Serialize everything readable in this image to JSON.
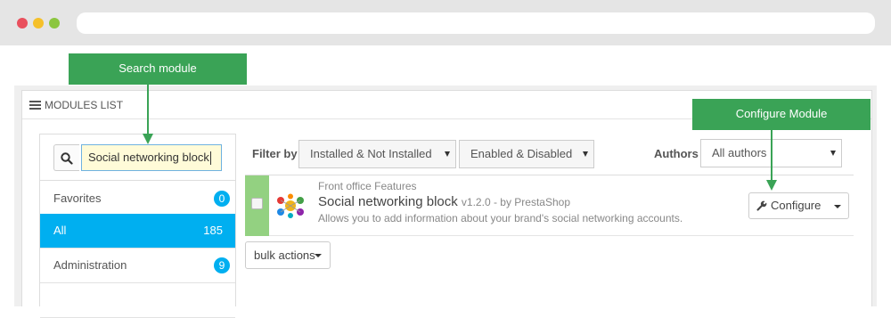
{
  "panel": {
    "title": "MODULES LIST"
  },
  "search": {
    "value": "Social networking block"
  },
  "categories": [
    {
      "label": "Favorites",
      "count": "0"
    },
    {
      "label": "All",
      "count": "185"
    },
    {
      "label": "Administration",
      "count": "9"
    }
  ],
  "filters": {
    "label": "Filter by",
    "install": "Installed & Not Installed",
    "status": "Enabled & Disabled",
    "authors_label": "Authors",
    "authors": "All authors"
  },
  "module": {
    "category": "Front office Features",
    "name": "Social networking block",
    "version": "v1.2.0 - by PrestaShop",
    "description": "Allows you to add information about your brand's social networking accounts.",
    "configure_label": "Configure"
  },
  "bulk": {
    "label": "bulk actions"
  },
  "callouts": {
    "search": "Search module",
    "configure": "Configure Module"
  },
  "colors": {
    "accent": "#00aff0",
    "callout": "#3aa356",
    "enabled_row": "#93d181"
  }
}
